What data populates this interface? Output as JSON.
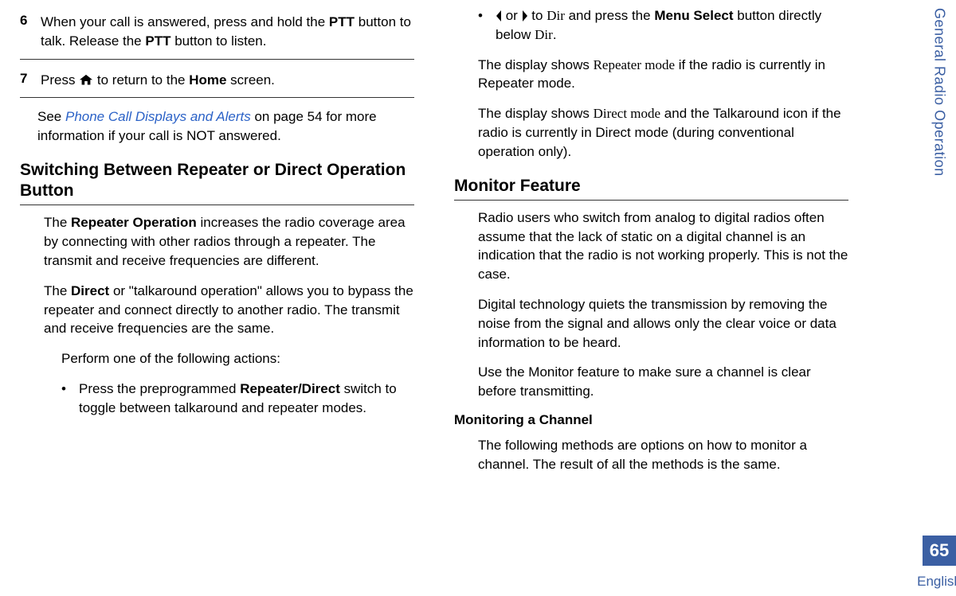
{
  "sidebar": {
    "section": "General Radio Operation",
    "page_number": "65",
    "language": "English"
  },
  "left": {
    "step6": {
      "num": "6",
      "t1": "When your call is answered, press and hold the ",
      "ptt1": "PTT",
      "t2": " button to talk. Release the ",
      "ptt2": "PTT",
      "t3": " button to listen."
    },
    "step7": {
      "num": "7",
      "t1": "Press ",
      "t2": " to return to the ",
      "home": "Home",
      "t3": " screen."
    },
    "note": {
      "t1": "See ",
      "link": "Phone Call Displays and Alerts",
      "t2": " on page 54 for more information if your call is NOT answered."
    },
    "h2": "Switching Between Repeater or Direct Operation Button",
    "p1": {
      "t1": "The ",
      "b": "Repeater Operation",
      "t2": " increases the radio coverage area by connecting with other radios through a repeater. The transmit and receive frequencies are different."
    },
    "p2": {
      "t1": "The ",
      "b": "Direct",
      "t2": " or \"talkaround operation\" allows you to bypass the repeater and connect directly to another radio. The transmit and receive frequencies are the same."
    },
    "action_intro": "Perform one of the following actions:",
    "bullet1": {
      "t1": "Press the preprogrammed ",
      "b": "Repeater/Direct",
      "t2": " switch to toggle between talkaround and repeater modes."
    }
  },
  "right": {
    "bullet2": {
      "t1": " or ",
      "t2": " to ",
      "dir1": "Dir",
      "t3": " and press the ",
      "b": "Menu Select",
      "t4": " button directly below ",
      "dir2": "Dir",
      "t5": "."
    },
    "p1": {
      "t1": "The display shows ",
      "d": "Repeater mode",
      "t2": " if the radio is currently in Repeater mode."
    },
    "p2": {
      "t1": "The display shows ",
      "d": "Direct mode",
      "t2": " and the Talkaround icon if the radio is currently in Direct mode (during conventional operation only)."
    },
    "h2": "Monitor Feature",
    "mp1": "Radio users who switch from analog to digital radios often assume that the lack of static on a digital channel is an indication that the radio is not working properly. This is not the case.",
    "mp2": "Digital technology quiets the transmission by removing the noise from the signal and allows only the clear voice or data information to be heard.",
    "mp3": "Use the Monitor feature to make sure a channel is clear before transmitting.",
    "h3": "Monitoring a Channel",
    "mp4": "The following methods are options on how to monitor a channel. The result of all the methods is the same."
  }
}
